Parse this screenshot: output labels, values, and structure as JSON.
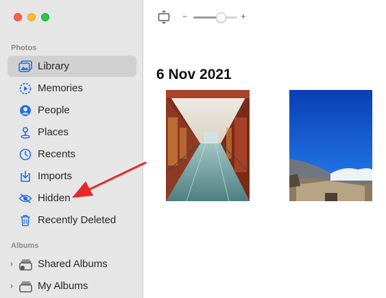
{
  "window": {
    "controls": [
      "close",
      "minimize",
      "zoom"
    ]
  },
  "sidebar": {
    "photos_section": "Photos",
    "items": [
      {
        "label": "Library",
        "icon": "library-icon",
        "selected": true
      },
      {
        "label": "Memories",
        "icon": "memories-icon"
      },
      {
        "label": "People",
        "icon": "people-icon"
      },
      {
        "label": "Places",
        "icon": "places-icon"
      },
      {
        "label": "Recents",
        "icon": "recents-icon"
      },
      {
        "label": "Imports",
        "icon": "imports-icon"
      },
      {
        "label": "Hidden",
        "icon": "hidden-icon"
      },
      {
        "label": "Recently Deleted",
        "icon": "trash-icon"
      }
    ],
    "albums_section": "Albums",
    "albums": [
      {
        "label": "Shared Albums",
        "icon": "shared-albums-icon"
      },
      {
        "label": "My Albums",
        "icon": "my-albums-icon"
      }
    ]
  },
  "toolbar": {
    "zoom_minus": "−",
    "zoom_plus": "+",
    "zoom_level": 0.62
  },
  "content": {
    "date_heading": "6 Nov 2021",
    "photos": [
      {
        "name": "corridor-photo"
      },
      {
        "name": "mountain-sky-photo"
      }
    ]
  },
  "colors": {
    "accent": "#1f6fe5",
    "annotation_arrow": "#e8252a",
    "sidebar_bg": "#e6e6e6",
    "selected_bg": "#d0d0d0"
  }
}
